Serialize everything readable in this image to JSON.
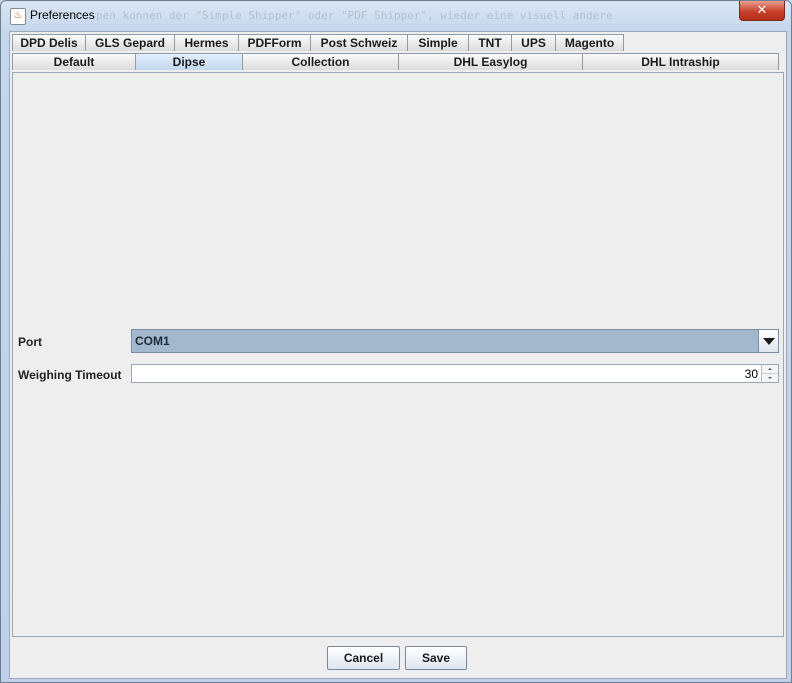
{
  "window": {
    "title": "Preferences",
    "background_text": "pen konnen der \"Simple Shipper\" oder \"PDF Shipper\", wieder eine visuell andere"
  },
  "tabs_row1": [
    "DPD Delis",
    "GLS Gepard",
    "Hermes",
    "PDFForm",
    "Post Schweiz",
    "Simple",
    "TNT",
    "UPS",
    "Magento"
  ],
  "tabs_row2": [
    "Default",
    "Dipse",
    "Collection",
    "DHL Easylog",
    "DHL Intraship"
  ],
  "selected_tab": "Dipse",
  "form": {
    "port_label": "Port",
    "port_value": "COM1",
    "timeout_label": "Weighing Timeout",
    "timeout_value": "30"
  },
  "buttons": {
    "cancel": "Cancel",
    "save": "Save"
  },
  "colors": {
    "selected_tab": "#c2d8ef",
    "combo_bg": "#a3b8cc",
    "close_button": "#c7412b"
  }
}
